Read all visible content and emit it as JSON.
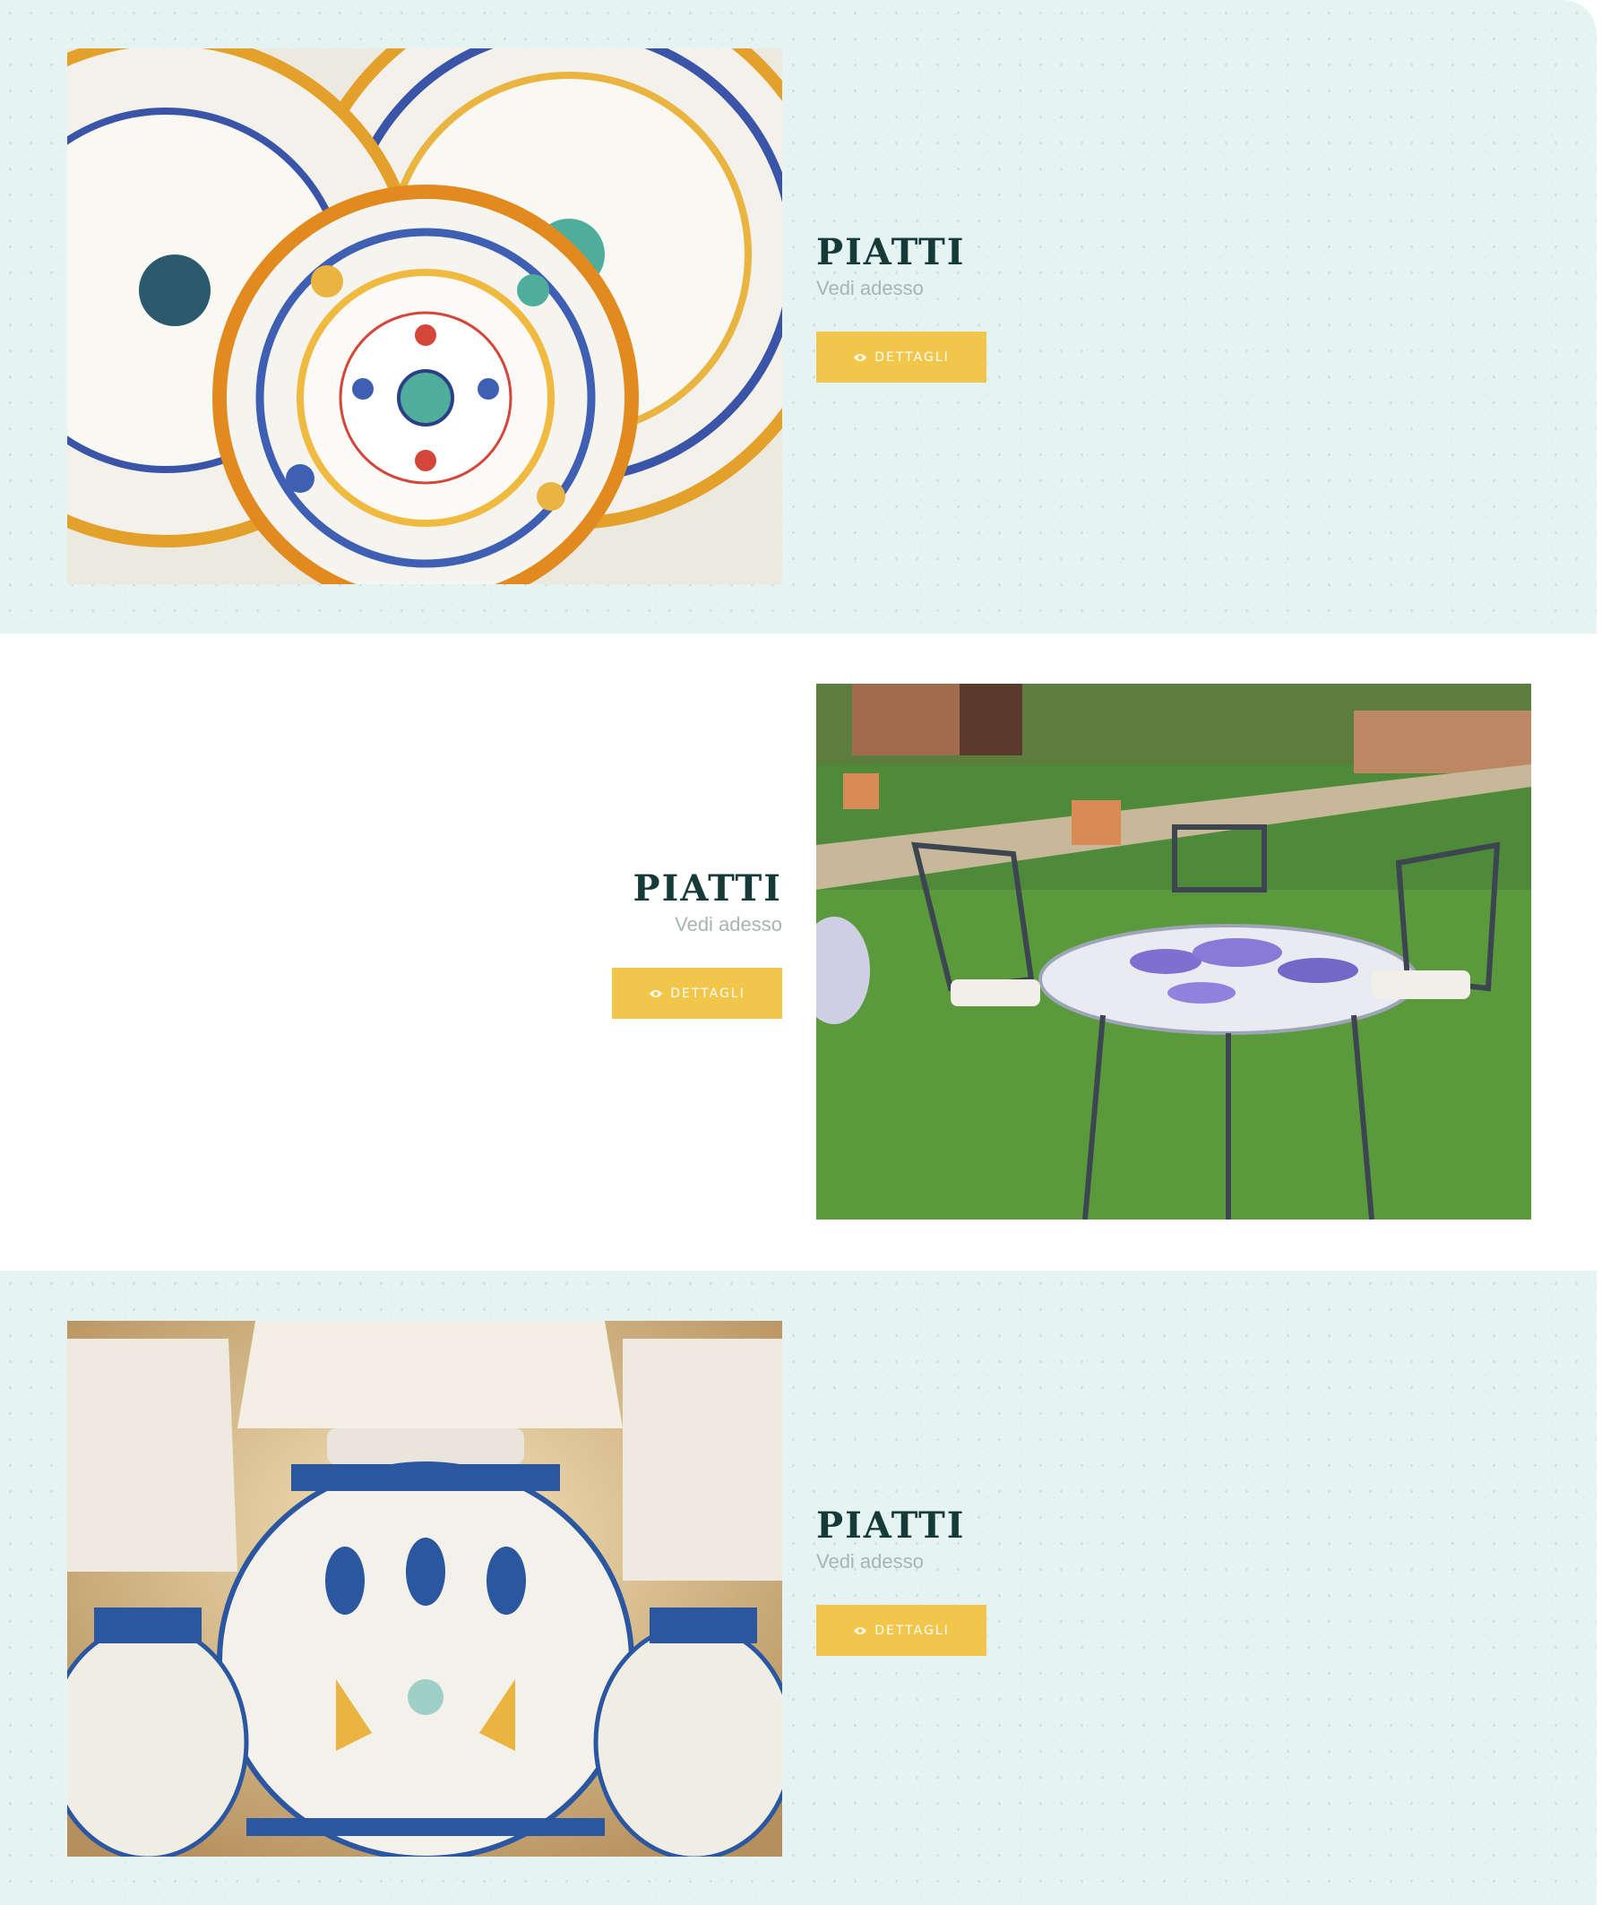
{
  "sections": [
    {
      "title": "PIATTI",
      "subtitle": "Vedi adesso",
      "button_label": "DETTAGLI",
      "button_icon": "eye-icon",
      "image": "decorated-ceramic-plates"
    },
    {
      "title": "PIATTI",
      "subtitle": "Vedi adesso",
      "button_label": "DETTAGLI",
      "button_icon": "eye-icon",
      "image": "ceramic-garden-table-wisteria"
    },
    {
      "title": "PIATTI",
      "subtitle": "Vedi adesso",
      "button_label": "DETTAGLI",
      "button_icon": "eye-icon",
      "image": "ceramic-table-lamps"
    }
  ],
  "colors": {
    "band_background": "#e6f3f3",
    "button": "#f1c64a",
    "title": "#153a38",
    "subtitle": "#a9b4b3"
  }
}
